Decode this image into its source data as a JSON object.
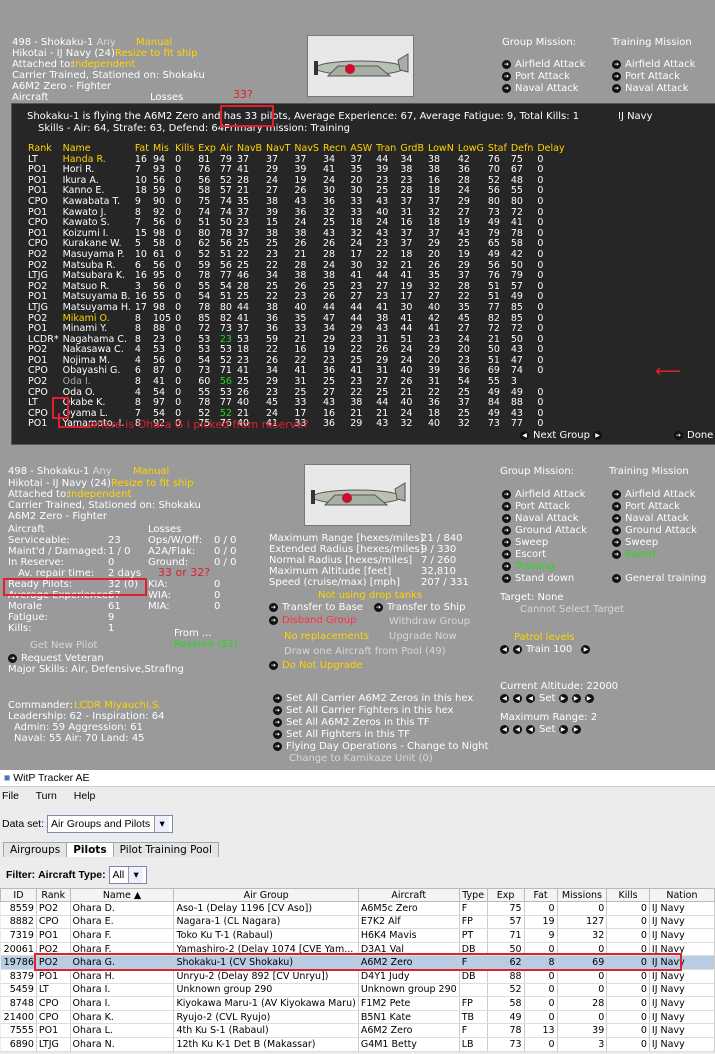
{
  "top_panel": {
    "unit_line": "498 - Shokaku-1",
    "any": "Any",
    "manual": "Manual",
    "hikotai": "Hikotai - IJ Navy (24)",
    "resize": "Resize to fit ship",
    "attached_label": "Attached to:",
    "attached_value": "Independent",
    "carrier_line": "Carrier Trained, Stationed on: Shokaku",
    "type_line": "A6M2 Zero - Fighter",
    "aircraft_cut": "Aircraft",
    "losses_cut": "Losses",
    "group_mission": "Group Mission:",
    "training_mission": "Training Mission",
    "missions_left": [
      "Airfield Attack",
      "Port Attack",
      "Naval Attack",
      "Ground Attack"
    ],
    "missions_right": [
      "Airfield Attack",
      "Port Attack",
      "Naval Attack",
      "Ground Attack"
    ]
  },
  "pilot_window": {
    "summary": "Shokaku-1 is flying the A6M2 Zero and has 33 pilots, Average Experience: 67, Average Fatigue: 9, Total Kills: 1",
    "nation": "IJ Navy",
    "skills": "Skills - Air: 64, Strafe: 63, Defend: 64",
    "primary": "Primary mission: Training",
    "headers": [
      "Rank",
      "Name",
      "Fat",
      "Mis",
      "Kills",
      "Exp",
      "Air",
      "NavB",
      "NavT",
      "NavS",
      "Recn",
      "ASW",
      "Tran",
      "GrdB",
      "LowN",
      "LowG",
      "Staf",
      "Defn",
      "Delay"
    ],
    "rows": [
      [
        "LT",
        "Handa R.",
        "16",
        "94",
        "0",
        "81",
        "79",
        "37",
        "37",
        "37",
        "34",
        "37",
        "44",
        "34",
        "38",
        "42",
        "76",
        "75",
        "0"
      ],
      [
        "PO1",
        "Hori R.",
        "7",
        "93",
        "0",
        "76",
        "77",
        "41",
        "29",
        "39",
        "41",
        "35",
        "39",
        "38",
        "38",
        "36",
        "70",
        "67",
        "0"
      ],
      [
        "PO1",
        "Ikura A.",
        "10",
        "56",
        "0",
        "56",
        "52",
        "28",
        "24",
        "19",
        "24",
        "20",
        "23",
        "23",
        "16",
        "28",
        "52",
        "48",
        "0"
      ],
      [
        "PO1",
        "Kanno E.",
        "18",
        "59",
        "0",
        "58",
        "57",
        "21",
        "27",
        "26",
        "30",
        "30",
        "25",
        "28",
        "18",
        "24",
        "56",
        "55",
        "0"
      ],
      [
        "CPO",
        "Kawabata T.",
        "9",
        "90",
        "0",
        "75",
        "74",
        "35",
        "38",
        "43",
        "36",
        "33",
        "43",
        "37",
        "37",
        "29",
        "80",
        "80",
        "0"
      ],
      [
        "PO1",
        "Kawato J.",
        "8",
        "92",
        "0",
        "74",
        "74",
        "37",
        "39",
        "36",
        "32",
        "33",
        "40",
        "31",
        "32",
        "27",
        "73",
        "72",
        "0"
      ],
      [
        "CPO",
        "Kawato S.",
        "7",
        "56",
        "0",
        "51",
        "50",
        "23",
        "15",
        "24",
        "25",
        "18",
        "24",
        "16",
        "18",
        "19",
        "49",
        "41",
        "0"
      ],
      [
        "PO1",
        "Koizumi I.",
        "15",
        "98",
        "0",
        "80",
        "78",
        "37",
        "38",
        "38",
        "43",
        "32",
        "43",
        "37",
        "37",
        "43",
        "79",
        "78",
        "0"
      ],
      [
        "CPO",
        "Kurakane W.",
        "5",
        "58",
        "0",
        "62",
        "56",
        "25",
        "25",
        "26",
        "26",
        "24",
        "23",
        "37",
        "29",
        "25",
        "65",
        "58",
        "0"
      ],
      [
        "PO2",
        "Masuyama P.",
        "10",
        "61",
        "0",
        "52",
        "51",
        "22",
        "23",
        "21",
        "28",
        "17",
        "22",
        "18",
        "20",
        "19",
        "49",
        "42",
        "0"
      ],
      [
        "PO2",
        "Matsuba R.",
        "6",
        "56",
        "0",
        "59",
        "56",
        "25",
        "22",
        "28",
        "24",
        "30",
        "32",
        "21",
        "26",
        "29",
        "56",
        "50",
        "0"
      ],
      [
        "LTJG",
        "Matsubara K.",
        "16",
        "95",
        "0",
        "78",
        "77",
        "46",
        "34",
        "38",
        "38",
        "41",
        "44",
        "41",
        "35",
        "37",
        "76",
        "79",
        "0"
      ],
      [
        "PO2",
        "Matsuo R.",
        "3",
        "56",
        "0",
        "55",
        "54",
        "28",
        "25",
        "26",
        "25",
        "23",
        "27",
        "19",
        "32",
        "28",
        "51",
        "57",
        "0"
      ],
      [
        "PO1",
        "Matsuyama B.",
        "16",
        "55",
        "0",
        "54",
        "51",
        "25",
        "22",
        "23",
        "26",
        "27",
        "23",
        "17",
        "27",
        "22",
        "51",
        "49",
        "0"
      ],
      [
        "LTJG",
        "Matsuyama H.",
        "17",
        "98",
        "0",
        "78",
        "80",
        "44",
        "38",
        "40",
        "44",
        "44",
        "41",
        "30",
        "40",
        "35",
        "77",
        "85",
        "0"
      ],
      [
        "PO2",
        "Mikami O.",
        "8",
        "105",
        "0",
        "85",
        "82",
        "41",
        "36",
        "35",
        "47",
        "44",
        "38",
        "41",
        "42",
        "45",
        "82",
        "85",
        "0"
      ],
      [
        "PO1",
        "Minami Y.",
        "8",
        "88",
        "0",
        "72",
        "73",
        "37",
        "36",
        "33",
        "34",
        "29",
        "43",
        "44",
        "41",
        "27",
        "72",
        "72",
        "0"
      ],
      [
        "LCDR*",
        "Nagahama C.",
        "8",
        "23",
        "0",
        "53",
        "23",
        "53",
        "59",
        "21",
        "29",
        "23",
        "31",
        "51",
        "23",
        "24",
        "21",
        "50",
        "0"
      ],
      [
        "PO2",
        "Nakasawa C.",
        "4",
        "53",
        "0",
        "53",
        "53",
        "18",
        "22",
        "16",
        "19",
        "22",
        "26",
        "24",
        "29",
        "20",
        "50",
        "43",
        "0"
      ],
      [
        "PO1",
        "Nojima M.",
        "4",
        "56",
        "0",
        "54",
        "52",
        "23",
        "26",
        "22",
        "23",
        "25",
        "29",
        "24",
        "20",
        "23",
        "51",
        "47",
        "0"
      ],
      [
        "CPO",
        "Obayashi G.",
        "6",
        "87",
        "0",
        "73",
        "71",
        "41",
        "34",
        "41",
        "36",
        "41",
        "31",
        "40",
        "39",
        "36",
        "69",
        "74",
        "0"
      ],
      [
        "PO2",
        "Oda I.",
        "8",
        "41",
        "0",
        "60",
        "56",
        "25",
        "29",
        "31",
        "25",
        "23",
        "27",
        "26",
        "31",
        "54",
        "55",
        "3"
      ],
      [
        "CPO",
        "Oda O.",
        "4",
        "54",
        "0",
        "55",
        "53",
        "26",
        "23",
        "25",
        "27",
        "22",
        "25",
        "21",
        "22",
        "25",
        "49",
        "49",
        "0"
      ],
      [
        "LT",
        "Okabe K.",
        "8",
        "97",
        "0",
        "78",
        "77",
        "40",
        "45",
        "33",
        "43",
        "38",
        "44",
        "40",
        "36",
        "37",
        "84",
        "88",
        "0"
      ],
      [
        "CPO",
        "Oyama L.",
        "7",
        "54",
        "0",
        "52",
        "52",
        "21",
        "24",
        "17",
        "16",
        "21",
        "21",
        "24",
        "18",
        "25",
        "49",
        "43",
        "0"
      ],
      [
        "PO1",
        "Yamamoto, I.",
        "8",
        "92",
        "0",
        "75",
        "76",
        "40",
        "41",
        "33",
        "36",
        "29",
        "43",
        "32",
        "40",
        "32",
        "73",
        "77",
        "0"
      ]
    ],
    "next_group": "Next Group",
    "done": "Done"
  },
  "annotations": {
    "q33": "33?",
    "ohara": "where is Ohara G i picked from reserve?",
    "q32": "33 or 32?"
  },
  "bottom_panel": {
    "unit_line": "498 - Shokaku-1",
    "any": "Any",
    "manual": "Manual",
    "hikotai": "Hikotai - IJ Navy (24)",
    "resize": "Resize to fit ship",
    "attached_label": "Attached to:",
    "attached_value": "Independent",
    "carrier_line": "Carrier Trained, Stationed on: Shokaku",
    "type_line": "A6M2 Zero - Fighter",
    "aircraft": "Aircraft",
    "losses": "Losses",
    "stats_left": [
      [
        "Serviceable:",
        "23"
      ],
      [
        "Maint'd / Damaged:",
        "1 / 0"
      ],
      [
        "In Reserve:",
        "0"
      ],
      [
        "Av. repair time:",
        "2 days"
      ],
      [
        "Ready Pilots:",
        "32 (0)"
      ],
      [
        "Average Experience:",
        "67"
      ],
      [
        "Morale",
        "61"
      ],
      [
        "Fatigue:",
        "9"
      ],
      [
        "Kills:",
        "1"
      ]
    ],
    "stats_mid": [
      [
        "Ops/W/Off:",
        "0 / 0"
      ],
      [
        "A2A/Flak:",
        "0 / 0"
      ],
      [
        "Ground:",
        "0 / 0"
      ],
      [
        "",
        ""
      ],
      [
        "KIA:",
        "0"
      ],
      [
        "WIA:",
        "0"
      ],
      [
        "MIA:",
        "0"
      ]
    ],
    "from": "From ...",
    "reserve": "Reserve (51)",
    "get_new": "Get New Pilot",
    "request_vet": "Request Veteran",
    "major_skills": "Major Skills: Air, Defensive,Strafing",
    "commander_label": "Commander:",
    "commander": "LCDR Miyauchi,S.",
    "leadership": "Leadership: 62 - Inspiration: 64",
    "admin": "Admin: 59  Aggression: 61",
    "naval": "Naval: 55  Air: 70  Land: 45",
    "ranges": [
      [
        "Maximum Range [hexes/miles]",
        "21 / 840"
      ],
      [
        "Extended Radius [hexes/miles]",
        "9 / 330"
      ],
      [
        "Normal Radius [hexes/miles]",
        "7 / 260"
      ],
      [
        "Maximum Altitude [feet]",
        "32,810"
      ],
      [
        "Speed (cruise/max) [mph]",
        "207 / 331"
      ]
    ],
    "drop_tanks": "Not using drop tanks",
    "transfer_base": "Transfer to Base",
    "transfer_ship": "Transfer to Ship",
    "disband": "Disband Group",
    "withdraw": "Withdraw Group",
    "no_repl": "No replacements",
    "upgrade_now": "Upgrade Now",
    "draw_one": "Draw one Aircraft from Pool (49)",
    "no_upgrade": "Do Not Upgrade",
    "set_lines": [
      "Set All Carrier A6M2 Zeros in this hex",
      "Set All Carrier Fighters in this hex",
      "Set All A6M2 Zeros in this TF",
      "Set All Fighters in this TF",
      "Flying Day Operations - Change to Night"
    ],
    "kamikaze": "Change to Kamikaze Unit (0)",
    "group_mission": "Group Mission:",
    "training_mission": "Training Mission",
    "missions_left": [
      "Airfield Attack",
      "Port Attack",
      "Naval Attack",
      "Ground Attack",
      "Sweep",
      "Escort",
      "Training",
      "Stand down"
    ],
    "missions_right": [
      "Airfield Attack",
      "Port Attack",
      "Naval Attack",
      "Ground Attack",
      "Sweep",
      "Escort",
      "General training"
    ],
    "target": "Target: None",
    "cannot_select": "Cannot Select Target",
    "patrol": "Patrol levels",
    "train": "Train",
    "train_val": "100",
    "altitude": "Current Altitude: 22000",
    "set": "Set",
    "max_range": "Maximum Range: 2"
  },
  "tracker": {
    "title": "WitP Tracker AE",
    "menus": [
      "File",
      "Turn",
      "Help"
    ],
    "dataset_label": "Data set:",
    "dataset_value": "Air Groups and Pilots",
    "tabs": [
      "Airgroups",
      "Pilots",
      "Pilot Training Pool"
    ],
    "filter_label": "Filter:",
    "aircraft_type_label": "Aircraft Type:",
    "aircraft_type_value": "All",
    "columns": [
      "ID",
      "Rank",
      "Name ▲",
      "Air Group",
      "Aircraft",
      "Type",
      "Exp",
      "Fat",
      "Missions",
      "Kills",
      "Nation"
    ],
    "rows": [
      [
        "8559",
        "PO2",
        "Ohara D.",
        "Aso-1 (Delay 1196 [CV Aso])",
        "A6M5c Zero",
        "F",
        "75",
        "0",
        "0",
        "0",
        "IJ Navy"
      ],
      [
        "8882",
        "CPO",
        "Ohara E.",
        "Nagara-1 (CL Nagara)",
        "E7K2 Alf",
        "FP",
        "57",
        "19",
        "127",
        "0",
        "IJ Navy"
      ],
      [
        "7319",
        "PO1",
        "Ohara F.",
        "Toko Ku T-1 (Rabaul)",
        "H6K4 Mavis",
        "PT",
        "71",
        "9",
        "32",
        "0",
        "IJ Navy"
      ],
      [
        "20061",
        "PO2",
        "Ohara F.",
        "Yamashiro-2 (Delay 1074 [CVE Yam...",
        "D3A1 Val",
        "DB",
        "50",
        "0",
        "0",
        "0",
        "IJ Navy"
      ],
      [
        "19786",
        "PO2",
        "Ohara G.",
        "Shokaku-1 (CV Shokaku)",
        "A6M2 Zero",
        "F",
        "62",
        "8",
        "69",
        "0",
        "IJ Navy"
      ],
      [
        "8379",
        "PO1",
        "Ohara H.",
        "Unryu-2 (Delay 892 [CV Unryu])",
        "D4Y1 Judy",
        "DB",
        "88",
        "0",
        "0",
        "0",
        "IJ Navy"
      ],
      [
        "5459",
        "LT",
        "Ohara I.",
        "Unknown group 290",
        "Unknown group 290",
        "",
        "52",
        "0",
        "0",
        "0",
        "IJ Navy"
      ],
      [
        "8748",
        "CPO",
        "Ohara I.",
        "Kiyokawa Maru-1 (AV Kiyokawa Maru)",
        "F1M2 Pete",
        "FP",
        "58",
        "0",
        "28",
        "0",
        "IJ Navy"
      ],
      [
        "21400",
        "CPO",
        "Ohara K.",
        "Ryujo-2 (CVL Ryujo)",
        "B5N1 Kate",
        "TB",
        "49",
        "0",
        "0",
        "0",
        "IJ Navy"
      ],
      [
        "7555",
        "PO1",
        "Ohara L.",
        "4th Ku S-1 (Rabaul)",
        "A6M2 Zero",
        "F",
        "78",
        "13",
        "39",
        "0",
        "IJ Navy"
      ],
      [
        "6890",
        "LTJG",
        "Ohara N.",
        "12th Ku K-1 Det B (Makassar)",
        "G4M1 Betty",
        "LB",
        "73",
        "0",
        "3",
        "0",
        "IJ Navy"
      ]
    ]
  }
}
